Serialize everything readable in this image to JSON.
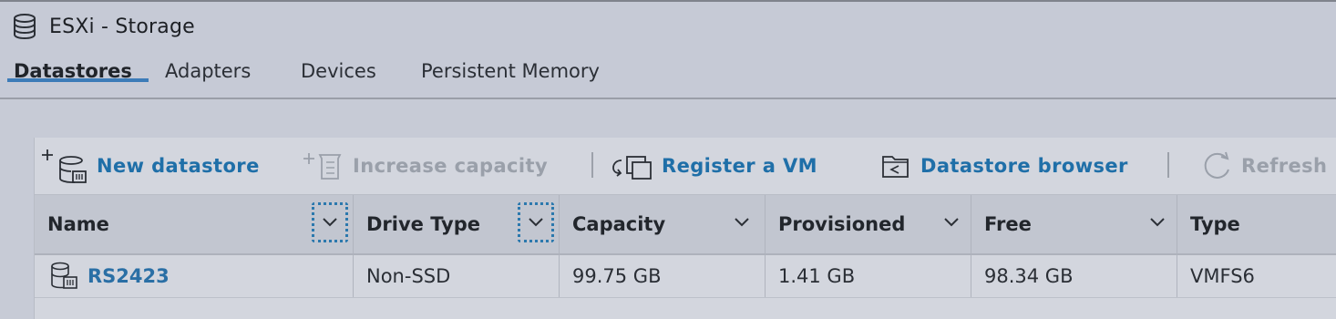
{
  "window": {
    "title": "ESXi - Storage",
    "icon": "database-icon"
  },
  "tabs": [
    {
      "label": "Datastores",
      "active": true
    },
    {
      "label": "Adapters",
      "active": false
    },
    {
      "label": "Devices",
      "active": false
    },
    {
      "label": "Persistent Memory",
      "active": false
    }
  ],
  "toolbar": {
    "new_datastore": {
      "label": "New datastore",
      "icon": "new-datastore-icon",
      "enabled": true
    },
    "increase_capacity": {
      "label": "Increase capacity",
      "icon": "increase-capacity-icon",
      "enabled": false
    },
    "register_vm": {
      "label": "Register a VM",
      "icon": "register-vm-icon",
      "enabled": true
    },
    "datastore_browser": {
      "label": "Datastore browser",
      "icon": "datastore-browser-icon",
      "enabled": true
    },
    "refresh": {
      "label": "Refresh",
      "icon": "refresh-icon",
      "enabled": false
    }
  },
  "table": {
    "columns": [
      "Name",
      "Drive Type",
      "Capacity",
      "Provisioned",
      "Free",
      "Type"
    ],
    "rows": [
      {
        "name": "RS2423",
        "drive_type": "Non-SSD",
        "capacity": "99.75 GB",
        "provisioned": "1.41 GB",
        "free": "98.34 GB",
        "type": "VMFS6"
      }
    ]
  },
  "colors": {
    "accent": "#3d7cb8",
    "link": "#1f6fa8",
    "disabled": "#9aa0aa",
    "background": "#c6cad6"
  }
}
